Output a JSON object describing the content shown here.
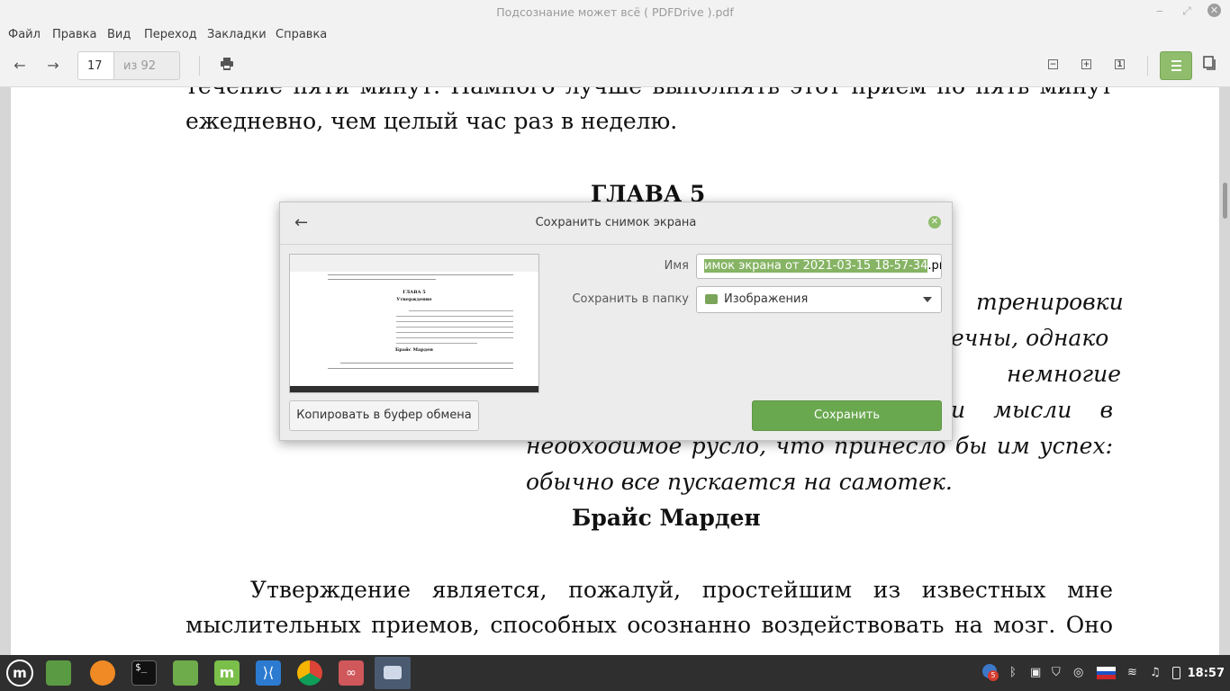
{
  "window": {
    "title": "Подсознание может всё ( PDFDrive ).pdf"
  },
  "menu": [
    "Файл",
    "Правка",
    "Вид",
    "Переход",
    "Закладки",
    "Справка"
  ],
  "toolbar": {
    "page_number": "17",
    "page_of": "из 92"
  },
  "document": {
    "lines_top": [
      "течение пяти минут. Намного лучше выполнять этот прием по пять минут",
      "ежедневно, чем целый час раз в неделю."
    ],
    "chapter": "ГЛАВА 5",
    "epigraph": [
      "тренировки",
      "ечны, однако",
      "немногие",
      "и мысли в",
      "необходимое русло, что принесло бы им успех:",
      "обычно все пускается на самотек."
    ],
    "author": "Брайс Марден",
    "para": [
      "Утверждение является, пожалуй, простейшим из известных мне",
      "мыслительных приемов, способных осознанно воздействовать на мозг. Оно"
    ]
  },
  "dialog": {
    "title": "Сохранить снимок экрана",
    "name_label": "Имя",
    "name_selected": "имок экрана от 2021-03-15 18-57-34",
    "name_ext": ".png",
    "folder_label": "Сохранить в папку",
    "folder_value": "Изображения",
    "copy_button": "Копировать в буфер обмена",
    "save_button": "Сохранить"
  },
  "preview": {
    "chapter": "ГЛАВА 5",
    "subtitle": "Утверждение",
    "author": "Брайс Марден"
  },
  "taskbar": {
    "notification_count": "5",
    "clock": "18:57"
  },
  "colors": {
    "accent": "#6aa84f",
    "taskbar": "#2f2f2f"
  }
}
